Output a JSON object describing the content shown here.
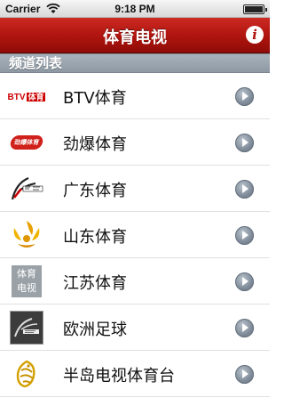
{
  "status_bar": {
    "carrier": "Carrier",
    "time": "9:18 PM"
  },
  "nav": {
    "title": "体育电视",
    "info_label": "i"
  },
  "section": {
    "header": "频道列表"
  },
  "channels": [
    {
      "label": "BTV体育",
      "logo_text": "BTV",
      "logo_badge": "体育",
      "logo_icon": "btv-logo-icon"
    },
    {
      "label": "劲爆体育",
      "logo_text": "劲爆体育",
      "logo_icon": "jinbao-logo-icon"
    },
    {
      "label": "广东体育",
      "logo_icon": "guangdong-logo-icon"
    },
    {
      "label": "山东体育",
      "logo_icon": "shandong-logo-icon"
    },
    {
      "label": "江苏体育",
      "logo_text_line1": "体育",
      "logo_text_line2": "电视",
      "logo_icon": "jiangsu-logo-icon"
    },
    {
      "label": "欧洲足球",
      "logo_icon": "euro-football-logo-icon"
    },
    {
      "label": "半岛电视体育台",
      "logo_icon": "aljazeera-logo-icon"
    }
  ],
  "colors": {
    "nav_red": "#b1150f",
    "section_gray": "#8e99a4",
    "disclosure_blue_gray": "#7c8896"
  }
}
